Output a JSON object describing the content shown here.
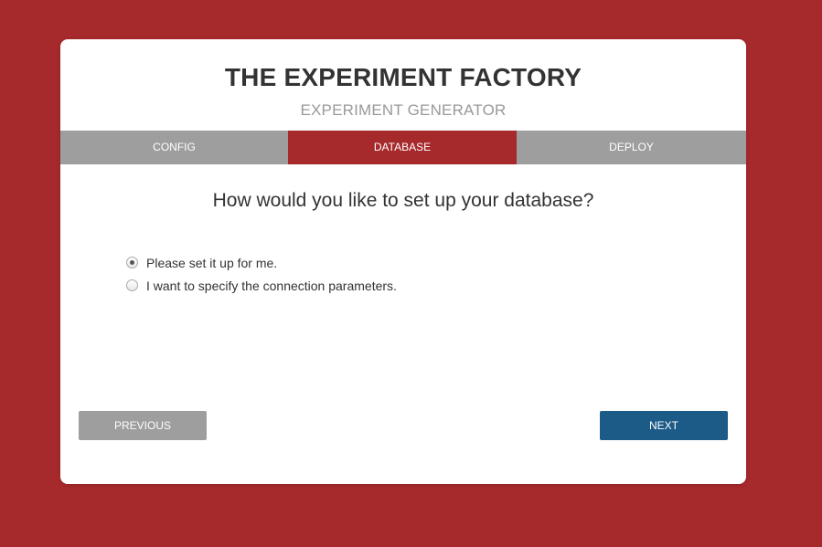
{
  "header": {
    "title": "THE EXPERIMENT FACTORY",
    "subtitle": "EXPERIMENT GENERATOR"
  },
  "tabs": [
    {
      "label": "CONFIG",
      "active": false
    },
    {
      "label": "DATABASE",
      "active": true
    },
    {
      "label": "DEPLOY",
      "active": false
    }
  ],
  "main": {
    "question": "How would you like to set up your database?",
    "options": [
      {
        "label": "Please set it up for me.",
        "selected": true
      },
      {
        "label": "I want to specify the connection parameters.",
        "selected": false
      }
    ]
  },
  "footer": {
    "previous_label": "PREVIOUS",
    "next_label": "NEXT"
  },
  "colors": {
    "background": "#a6292c",
    "active_tab": "#a6292c",
    "inactive_tab": "#9e9e9e",
    "next_button": "#1c5a87"
  }
}
